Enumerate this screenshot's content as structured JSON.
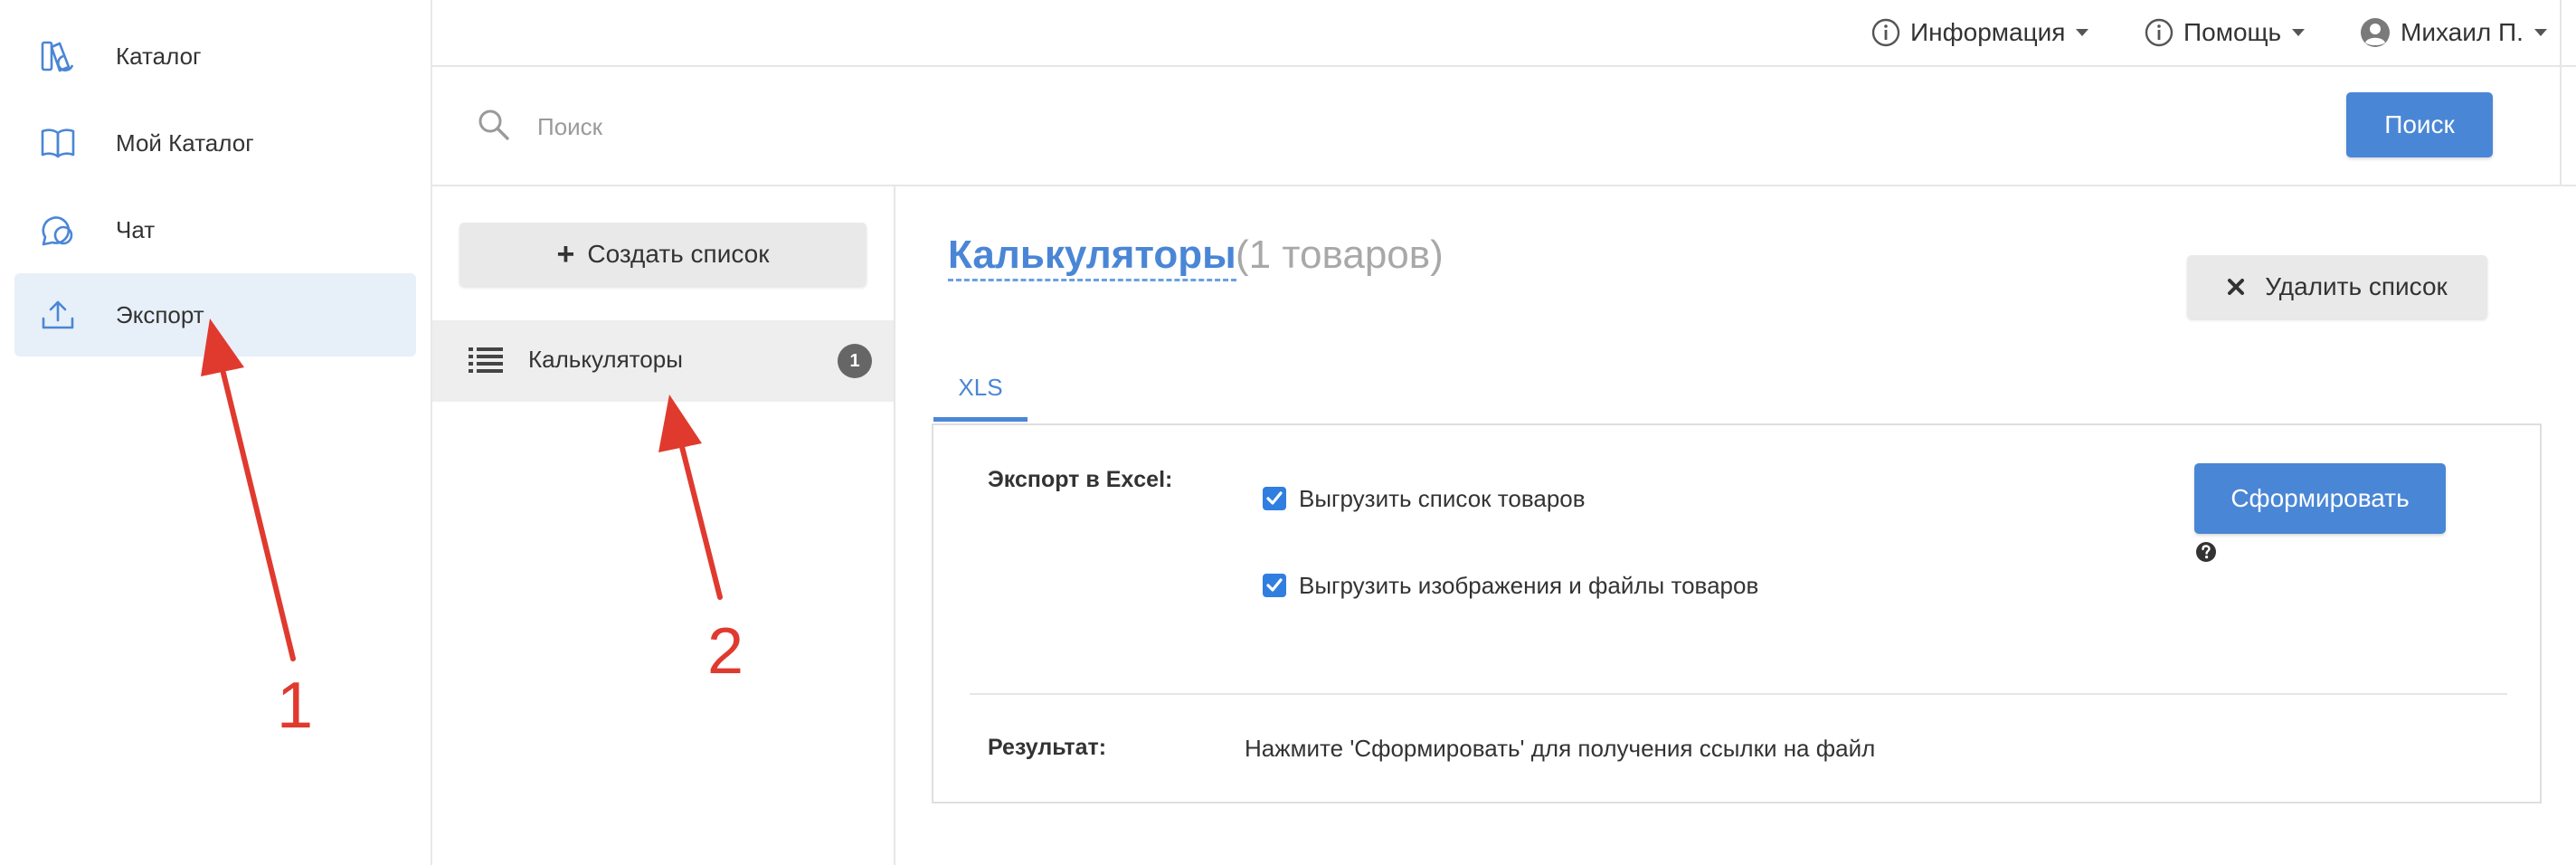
{
  "sidebar": {
    "items": [
      {
        "label": "Каталог",
        "icon": "catalog-icon",
        "active": false
      },
      {
        "label": "Мой Каталог",
        "icon": "book-icon",
        "active": false
      },
      {
        "label": "Чат",
        "icon": "chat-icon",
        "active": false
      },
      {
        "label": "Экспорт",
        "icon": "upload-icon",
        "active": true
      }
    ]
  },
  "topbar": {
    "info_label": "Информация",
    "help_label": "Помощь",
    "user_label": "Михаил П."
  },
  "search": {
    "placeholder": "Поиск",
    "value": "",
    "button_label": "Поиск"
  },
  "lists": {
    "create_button_label": "Создать список",
    "items": [
      {
        "name": "Калькуляторы",
        "count": "1",
        "selected": true
      }
    ]
  },
  "main": {
    "title": "Калькуляторы",
    "count_text": "(1 товаров)",
    "delete_button_label": "Удалить список",
    "tabs": [
      {
        "label": "XLS",
        "active": true
      }
    ],
    "export": {
      "section_label": "Экспорт в Excel:",
      "options": [
        {
          "label": "Выгрузить список товаров",
          "checked": true
        },
        {
          "label": "Выгрузить изображения и файлы товаров",
          "checked": true
        }
      ],
      "generate_button_label": "Сформировать",
      "result_label": "Результат:",
      "result_text": "Нажмите 'Сформировать' для получения ссылки на файл"
    }
  },
  "annotations": [
    {
      "number": "1"
    },
    {
      "number": "2"
    }
  ],
  "colors": {
    "accent": "#4a86d6",
    "active_nav_bg": "#e7eff8",
    "annotation": "#e03a2f",
    "checkbox": "#2f7ee0"
  }
}
